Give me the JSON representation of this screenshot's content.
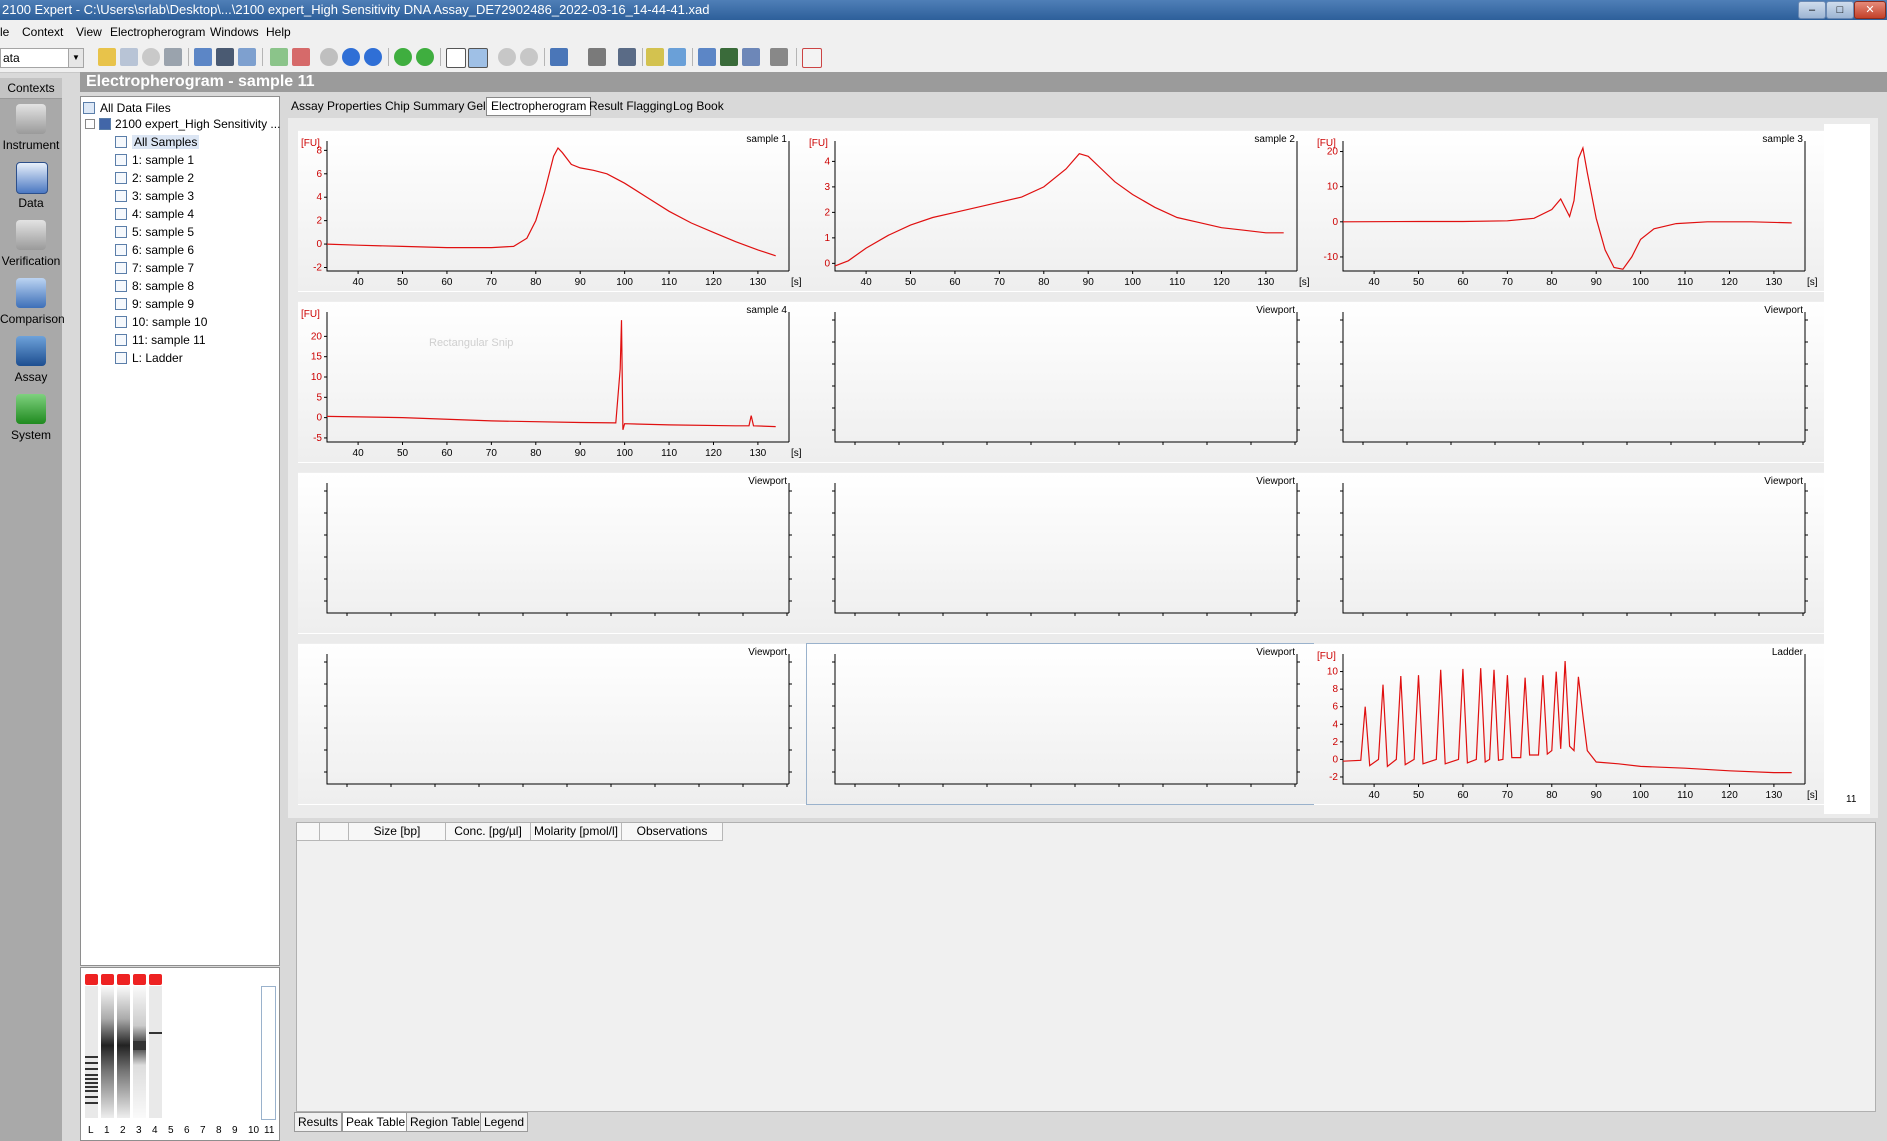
{
  "window": {
    "title": "2100 Expert - C:\\Users\\srlab\\Desktop\\...\\2100 expert_High Sensitivity DNA Assay_DE72902486_2022-03-16_14-44-41.xad",
    "min": "–",
    "max": "□",
    "close": "✕"
  },
  "menu": [
    "le",
    "Context",
    "View",
    "Electropherogram",
    "Windows",
    "Help"
  ],
  "toolbar": {
    "combo_value": "ata"
  },
  "contexts": {
    "header": "Contexts",
    "items": [
      {
        "label": "Instrument",
        "icon": "instrument-icon"
      },
      {
        "label": "Data",
        "icon": "data-icon"
      },
      {
        "label": "Verification",
        "icon": "verification-icon"
      },
      {
        "label": "Comparison",
        "icon": "comparison-icon"
      },
      {
        "label": "Assay",
        "icon": "assay-icon"
      },
      {
        "label": "System",
        "icon": "system-icon"
      }
    ]
  },
  "page_title": "Electropherogram - sample 11",
  "tree": {
    "root": "All Data Files",
    "file": "2100 expert_High Sensitivity ...",
    "items": [
      "All Samples",
      "1: sample 1",
      "2: sample 2",
      "3: sample 3",
      "4: sample 4",
      "5: sample 5",
      "6: sample 6",
      "7: sample 7",
      "8: sample 8",
      "9: sample 9",
      "10: sample 10",
      "11: sample 11",
      "L: Ladder"
    ],
    "selected": "All Samples"
  },
  "gel": {
    "lanes": [
      "L",
      "1",
      "2",
      "3",
      "4",
      "5",
      "6",
      "7",
      "8",
      "9",
      "10",
      "11"
    ]
  },
  "tabs": [
    "Assay Properties",
    "Chip Summary",
    "Gel",
    "Electropherogram",
    "Result Flagging",
    "Log Book"
  ],
  "active_tab": "Electropherogram",
  "colors": {
    "trace": "#e01010",
    "axis": "#000000",
    "fu_label": "#cc0000"
  },
  "viewports": [
    {
      "title": "sample 1",
      "y_label": "[FU]",
      "x_unit": "[s]",
      "y_ticks": [
        "8",
        "6",
        "4",
        "2",
        "0",
        "-2"
      ]
    },
    {
      "title": "sample 2",
      "y_label": "[FU]",
      "x_unit": "[s]",
      "y_ticks": [
        "4",
        "3",
        "2",
        "1",
        "0"
      ]
    },
    {
      "title": "sample 3",
      "y_label": "[FU]",
      "x_unit": "[s]",
      "y_ticks": [
        "20",
        "10",
        "0",
        "-10"
      ]
    },
    {
      "title": "sample 4",
      "y_label": "[FU]",
      "x_unit": "[s]",
      "y_ticks": [
        "20",
        "15",
        "10",
        "5",
        "0",
        "-5"
      ],
      "overlay_text": "Rectangular Snip"
    },
    {
      "title": "Viewport"
    },
    {
      "title": "Viewport"
    },
    {
      "title": "Viewport"
    },
    {
      "title": "Viewport"
    },
    {
      "title": "Viewport"
    },
    {
      "title": "Viewport"
    },
    {
      "title": "Viewport"
    },
    {
      "title": "Ladder",
      "y_label": "[FU]",
      "x_unit": "[s]",
      "y_ticks": [
        "10",
        "8",
        "6",
        "4",
        "2",
        "0",
        "-2"
      ]
    }
  ],
  "x_ticks": [
    "40",
    "50",
    "60",
    "70",
    "80",
    "90",
    "100",
    "110",
    "120",
    "130"
  ],
  "side_label": "11",
  "chart_data": [
    {
      "type": "line",
      "title": "sample 1",
      "ylabel": "[FU]",
      "xlabel": "[s]",
      "xlim": [
        33,
        137
      ],
      "ylim": [
        -2.3,
        8.8
      ],
      "series": [
        {
          "values": [
            [
              33,
              0.0
            ],
            [
              40,
              -0.1
            ],
            [
              50,
              -0.2
            ],
            [
              60,
              -0.3
            ],
            [
              70,
              -0.3
            ],
            [
              75,
              -0.2
            ],
            [
              78,
              0.5
            ],
            [
              80,
              2.0
            ],
            [
              82,
              4.5
            ],
            [
              84,
              7.5
            ],
            [
              85,
              8.2
            ],
            [
              86,
              7.8
            ],
            [
              88,
              6.8
            ],
            [
              90,
              6.5
            ],
            [
              93,
              6.3
            ],
            [
              96,
              6.0
            ],
            [
              100,
              5.2
            ],
            [
              105,
              4.0
            ],
            [
              110,
              2.8
            ],
            [
              115,
              1.8
            ],
            [
              120,
              1.0
            ],
            [
              125,
              0.2
            ],
            [
              130,
              -0.5
            ],
            [
              134,
              -1.0
            ]
          ]
        }
      ]
    },
    {
      "type": "line",
      "title": "sample 2",
      "ylabel": "[FU]",
      "xlabel": "[s]",
      "xlim": [
        33,
        137
      ],
      "ylim": [
        -0.3,
        4.8
      ],
      "series": [
        {
          "values": [
            [
              33,
              -0.1
            ],
            [
              36,
              0.1
            ],
            [
              40,
              0.6
            ],
            [
              45,
              1.1
            ],
            [
              50,
              1.5
            ],
            [
              55,
              1.8
            ],
            [
              60,
              2.0
            ],
            [
              65,
              2.2
            ],
            [
              70,
              2.4
            ],
            [
              75,
              2.6
            ],
            [
              80,
              3.0
            ],
            [
              85,
              3.7
            ],
            [
              88,
              4.3
            ],
            [
              90,
              4.2
            ],
            [
              93,
              3.7
            ],
            [
              96,
              3.2
            ],
            [
              100,
              2.7
            ],
            [
              105,
              2.2
            ],
            [
              110,
              1.8
            ],
            [
              115,
              1.6
            ],
            [
              120,
              1.4
            ],
            [
              125,
              1.3
            ],
            [
              130,
              1.2
            ],
            [
              134,
              1.2
            ]
          ]
        }
      ]
    },
    {
      "type": "line",
      "title": "sample 3",
      "ylabel": "[FU]",
      "xlabel": "[s]",
      "xlim": [
        33,
        137
      ],
      "ylim": [
        -14,
        23
      ],
      "series": [
        {
          "values": [
            [
              33,
              0.0
            ],
            [
              50,
              0.1
            ],
            [
              60,
              0.1
            ],
            [
              70,
              0.3
            ],
            [
              76,
              1.0
            ],
            [
              80,
              3.5
            ],
            [
              82,
              6.5
            ],
            [
              84,
              1.5
            ],
            [
              85,
              6.0
            ],
            [
              86,
              18.0
            ],
            [
              87,
              21.0
            ],
            [
              88,
              14.0
            ],
            [
              90,
              1.0
            ],
            [
              92,
              -8.0
            ],
            [
              94,
              -13.0
            ],
            [
              96,
              -13.5
            ],
            [
              98,
              -10.0
            ],
            [
              100,
              -5.0
            ],
            [
              103,
              -2.0
            ],
            [
              108,
              -0.5
            ],
            [
              115,
              0.0
            ],
            [
              125,
              0.0
            ],
            [
              134,
              -0.3
            ]
          ]
        }
      ]
    },
    {
      "type": "line",
      "title": "sample 4",
      "ylabel": "[FU]",
      "xlabel": "[s]",
      "xlim": [
        33,
        137
      ],
      "ylim": [
        -6,
        26
      ],
      "series": [
        {
          "values": [
            [
              33,
              0.3
            ],
            [
              50,
              0.0
            ],
            [
              70,
              -0.8
            ],
            [
              90,
              -1.2
            ],
            [
              98,
              -1.3
            ],
            [
              99,
              12.0
            ],
            [
              99.3,
              24.0
            ],
            [
              99.6,
              -3.0
            ],
            [
              100,
              -1.5
            ],
            [
              110,
              -1.8
            ],
            [
              125,
              -2.0
            ],
            [
              128,
              -2.0
            ],
            [
              128.5,
              0.5
            ],
            [
              129,
              -2.0
            ],
            [
              134,
              -2.2
            ]
          ]
        }
      ]
    },
    {
      "type": "line",
      "title": "Ladder",
      "ylabel": "[FU]",
      "xlabel": "[s]",
      "xlim": [
        33,
        137
      ],
      "ylim": [
        -2.8,
        12
      ],
      "series": [
        {
          "values": [
            [
              33,
              -0.2
            ],
            [
              37,
              -0.1
            ],
            [
              38,
              6.0
            ],
            [
              39,
              -0.7
            ],
            [
              41,
              0.0
            ],
            [
              42,
              8.5
            ],
            [
              43,
              -0.8
            ],
            [
              45,
              0.0
            ],
            [
              46,
              9.5
            ],
            [
              47,
              -0.6
            ],
            [
              49,
              0.0
            ],
            [
              50,
              9.6
            ],
            [
              51,
              -0.5
            ],
            [
              54,
              0.0
            ],
            [
              55,
              10.2
            ],
            [
              56,
              -0.5
            ],
            [
              59,
              0.0
            ],
            [
              60,
              10.3
            ],
            [
              61,
              -0.4
            ],
            [
              63,
              0.0
            ],
            [
              64,
              10.4
            ],
            [
              65,
              -0.3
            ],
            [
              66,
              0.0
            ],
            [
              67,
              10.2
            ],
            [
              68,
              -0.1
            ],
            [
              69,
              0.0
            ],
            [
              70,
              9.6
            ],
            [
              71,
              0.2
            ],
            [
              73,
              0.2
            ],
            [
              74,
              9.3
            ],
            [
              75,
              0.5
            ],
            [
              77,
              0.5
            ],
            [
              78,
              9.6
            ],
            [
              79,
              0.6
            ],
            [
              80,
              1.0
            ],
            [
              81,
              10.0
            ],
            [
              82,
              1.2
            ],
            [
              83,
              11.2
            ],
            [
              84,
              1.5
            ],
            [
              85,
              1.0
            ],
            [
              86,
              9.4
            ],
            [
              87,
              5.0
            ],
            [
              88,
              1.0
            ],
            [
              90,
              -0.3
            ],
            [
              95,
              -0.5
            ],
            [
              100,
              -0.8
            ],
            [
              110,
              -1.0
            ],
            [
              120,
              -1.3
            ],
            [
              130,
              -1.5
            ],
            [
              134,
              -1.5
            ]
          ]
        }
      ]
    }
  ],
  "results_table": {
    "columns": [
      "",
      "",
      "Size [bp]",
      "Conc. [pg/µl]",
      "Molarity [pmol/l]",
      "Observations"
    ]
  },
  "bottom_tabs": [
    "Results",
    "Peak Table",
    "Region Table",
    "Legend"
  ],
  "active_bottom_tab": "Peak Table"
}
